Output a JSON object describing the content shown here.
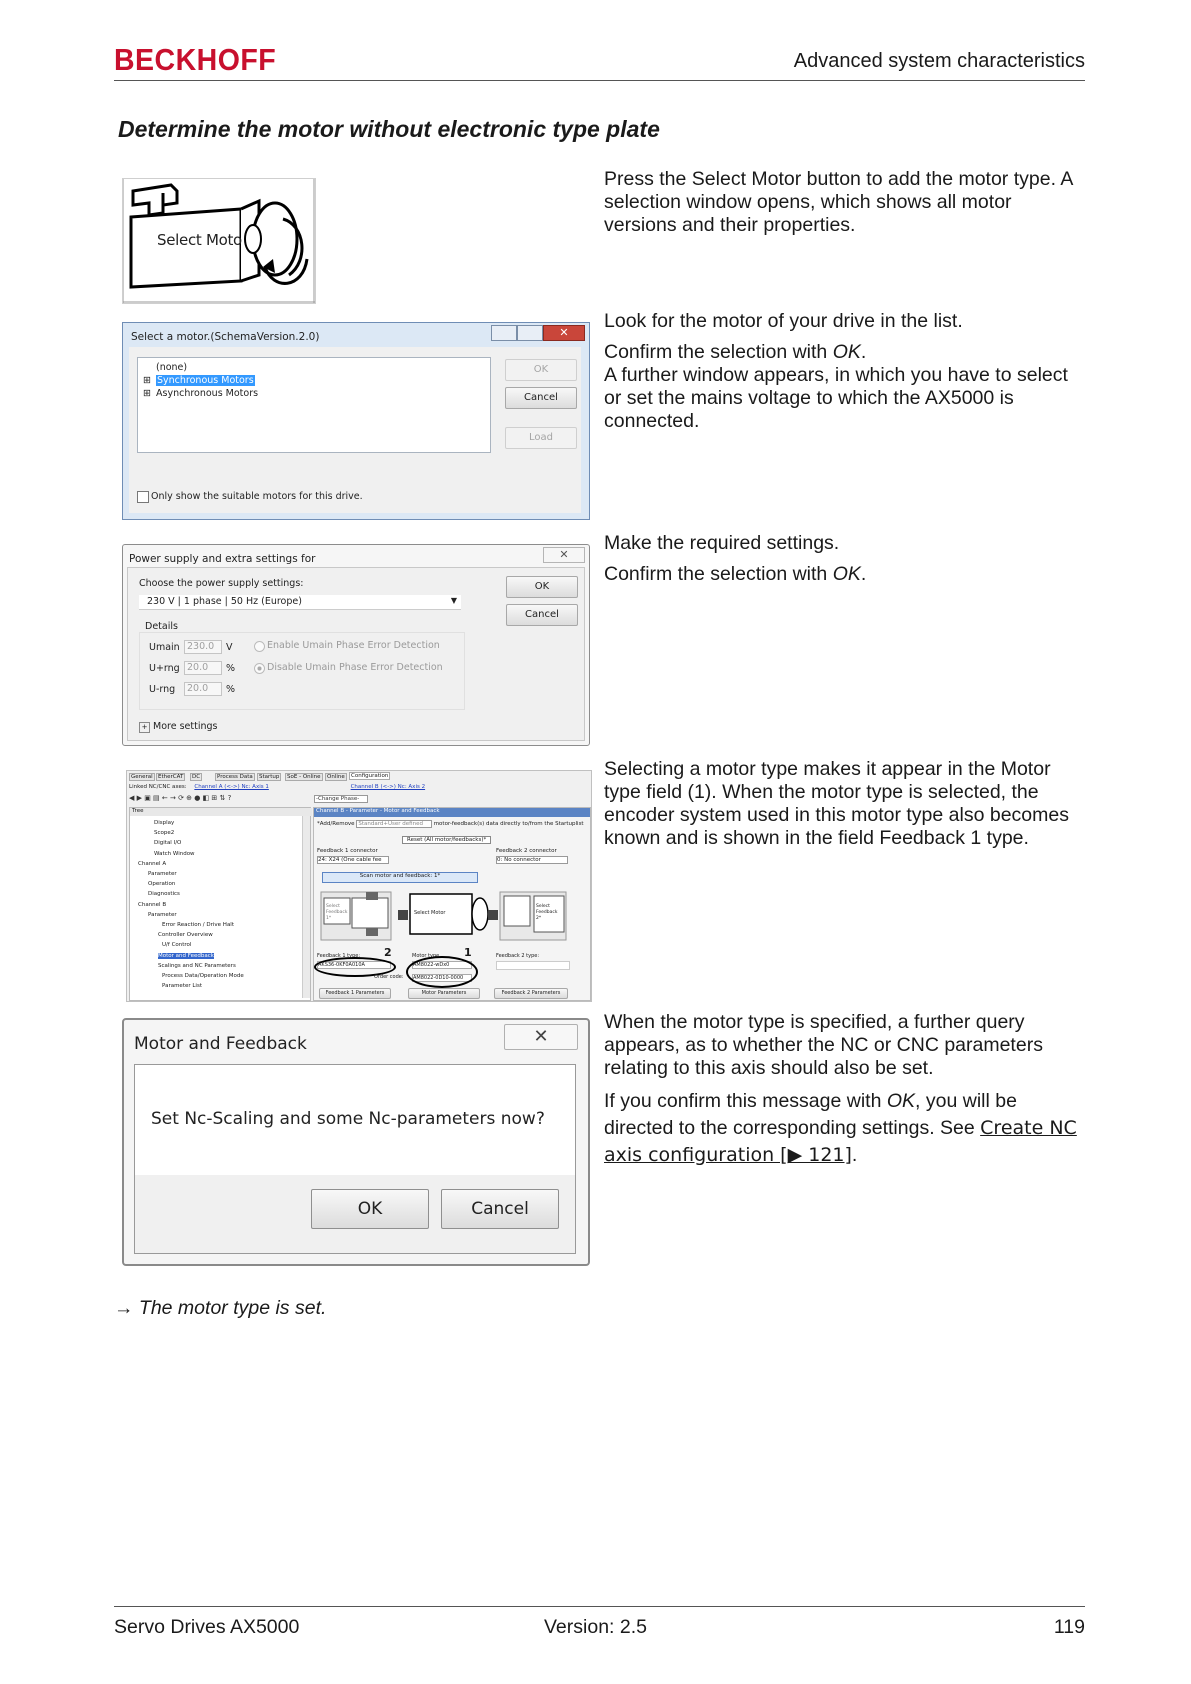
{
  "header": {
    "logo_text": "BECKHOFF",
    "title": "Advanced system characteristics"
  },
  "section_title": "Determine the motor without electronic type plate",
  "steps": [
    {
      "paragraphs": [
        "Press the Select Motor button to add the motor type. A selection window opens, which shows all motor versions and their properties."
      ],
      "image": {
        "button_label": "Select Motor"
      }
    },
    {
      "p1": "Look for the motor of your drive in the list.",
      "p2_pre": "Confirm the selection with ",
      "p2_em": "OK",
      "p2_post": ".",
      "p3": "A further window appears, in which you have to select or set the mains voltage to which the AX5000 is connected.",
      "image": {
        "title": "Select a motor.(SchemaVersion.2.0)",
        "tree": [
          "(none)",
          "Synchronous Motors",
          "Asynchronous Motors"
        ],
        "buttons": [
          "OK",
          "Cancel",
          "Load"
        ],
        "checkbox_label": "Only show the suitable motors for this drive."
      }
    },
    {
      "p1": "Make the required settings.",
      "p2_pre": "Confirm the selection with ",
      "p2_em": "OK",
      "p2_post": ".",
      "image": {
        "title": "Power supply and extra settings for",
        "prompt": "Choose the power supply settings:",
        "selected": "230 V | 1 phase | 50 Hz (Europe)",
        "ok": "OK",
        "cancel": "Cancel",
        "details_label": "Details",
        "rows": [
          {
            "label": "Umain",
            "value": "230.0",
            "unit": "V"
          },
          {
            "label": "U+rng",
            "value": "20.0",
            "unit": "%"
          },
          {
            "label": "U-rng",
            "value": "20.0",
            "unit": "%"
          }
        ],
        "radio_enable": "Enable Umain Phase Error Detection",
        "radio_disable": "Disable Umain Phase Error Detection",
        "more_settings": "More settings"
      }
    },
    {
      "paragraphs": [
        "Selecting a motor type makes it appear in the Motor type field (1). When the motor type is selected, the encoder system used in this motor type also becomes known and is shown in the field Feedback 1 type."
      ],
      "image": {
        "tabs": [
          "General",
          "EtherCAT",
          "DC",
          "Process Data",
          "Startup",
          "SoE - Online",
          "Online",
          "Configuration"
        ],
        "linked_label": "Linked NC/CNC axes:",
        "linked_a": "Channel A (<->) Nc: Axis 1",
        "linked_b": "Channel B (<->) Nc: Axis 2",
        "change_phase": "-Change Phase-",
        "tree_header": "Tree",
        "tree_items": [
          "Display",
          "Scope2",
          "Digital I/O",
          "Watch Window",
          "Channel A",
          "Parameter",
          "Operation",
          "Diagnostics",
          "Channel B",
          "Parameter",
          "Error Reaction / Drive Halt",
          "Controller Overview",
          "U/f Control",
          "Motor and Feedback",
          "Scalings and NC Parameters",
          "Process Data/Operation Mode",
          "Parameter List"
        ],
        "panel_header": "Channel B - Parameter - Motor and Feedback",
        "add_remove": "*Add/Remove",
        "add_remove_value": "Standard+User defined",
        "add_remove_tail": "motor-feedback(s) data directly to/from the Startuplist",
        "reset": "Reset (All motor/feedbacks)*",
        "fb1_conn_label": "Feedback 1 connector",
        "fb1_conn": "24: X24 (One cable fee",
        "fb2_conn_label": "Feedback 2 connector",
        "fb2_conn": "0: No connector",
        "scan": "Scan motor and feedback: 1*",
        "select_fb1": "Select Feedback 1*",
        "select_motor": "Select Motor",
        "select_fb2": "Select Feedback 2*",
        "fb1_type_label": "Feedback 1 type:",
        "fb1_type": "AKS36-0KF0A010A",
        "motor_type_label": "Motor type",
        "motor_type": "AM8022-wDx0",
        "order_code_label": "Order code:",
        "order_code": "AM8022-0D10-0000",
        "fb2_type_label": "Feedback 2 type:",
        "btn_fb1": "Feedback 1 Parameters",
        "btn_motor": "Motor Parameters",
        "btn_fb2": "Feedback 2 Parameters",
        "marker_1": "1",
        "marker_2": "2"
      }
    },
    {
      "p1": "When the motor type is specified, a further query appears, as to whether the NC or CNC parameters relating to this axis should also be set.",
      "p2_pre": "If you confirm this message with ",
      "p2_em": "OK",
      "p2_mid": ", you will be directed to the corresponding settings. See ",
      "p2_link": "Create NC axis configuration [▶ 121]",
      "p2_post": ".",
      "image": {
        "title": "Motor and Feedback",
        "message": "Set Nc-Scaling and some Nc-parameters now?",
        "ok": "OK",
        "cancel": "Cancel"
      }
    }
  ],
  "result": "→ The motor type is set.",
  "footer": {
    "left": "Servo Drives AX5000",
    "center": "Version: 2.5",
    "right": "119"
  }
}
